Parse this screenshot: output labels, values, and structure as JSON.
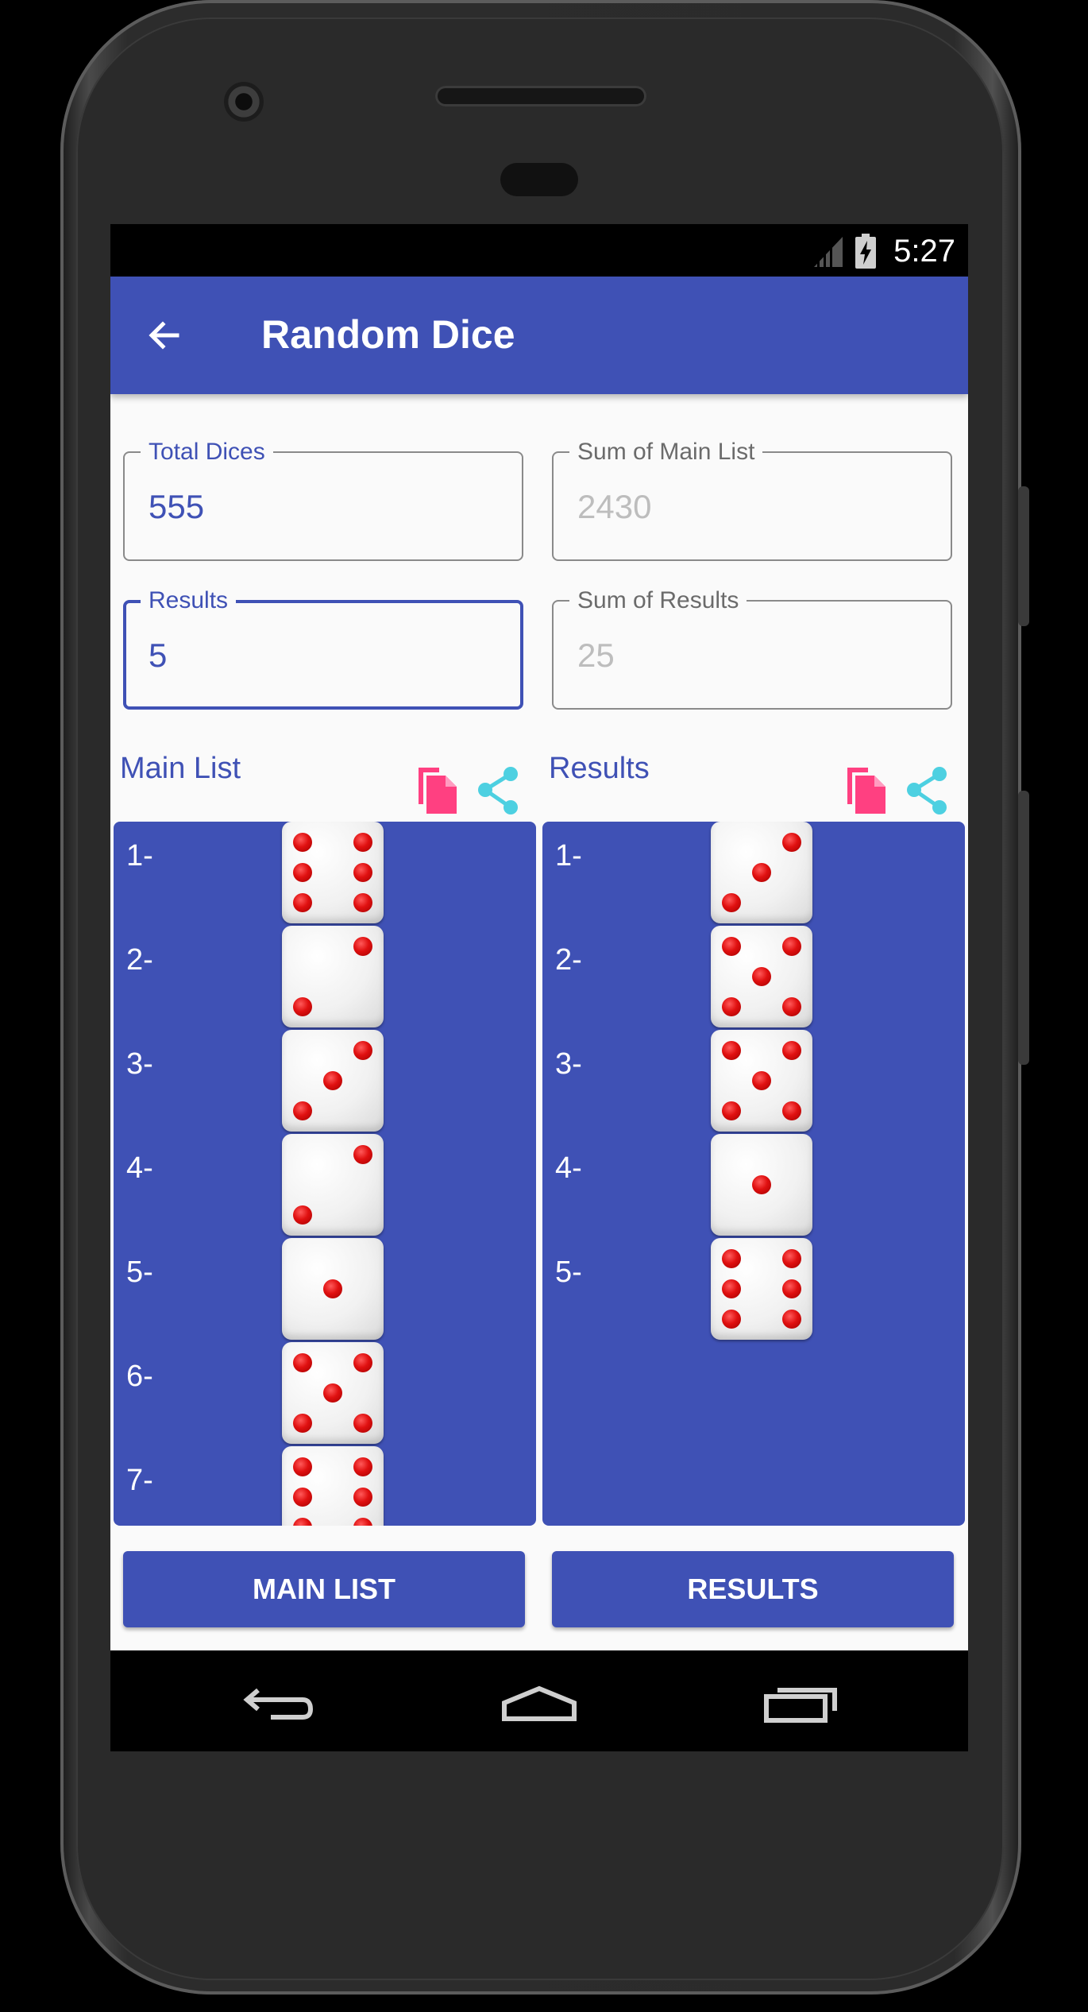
{
  "status_bar": {
    "time": "5:27"
  },
  "app_bar": {
    "title": "Random Dice"
  },
  "fields": {
    "total_dices": {
      "label": "Total Dices",
      "value": "555"
    },
    "sum_main_list": {
      "label": "Sum of Main List",
      "value": "2430"
    },
    "results": {
      "label": "Results",
      "value": "5"
    },
    "sum_results": {
      "label": "Sum of Results",
      "value": "25"
    }
  },
  "main_list": {
    "title": "Main List",
    "items": [
      {
        "index": "1-",
        "face": 6
      },
      {
        "index": "2-",
        "face": 2
      },
      {
        "index": "3-",
        "face": 3
      },
      {
        "index": "4-",
        "face": 2
      },
      {
        "index": "5-",
        "face": 1
      },
      {
        "index": "6-",
        "face": 5
      },
      {
        "index": "7-",
        "face": 6
      }
    ]
  },
  "results_list": {
    "title": "Results",
    "items": [
      {
        "index": "1-",
        "face": 3
      },
      {
        "index": "2-",
        "face": 5
      },
      {
        "index": "3-",
        "face": 5
      },
      {
        "index": "4-",
        "face": 1
      },
      {
        "index": "5-",
        "face": 6
      }
    ]
  },
  "buttons": {
    "main_list": "MAIN LIST",
    "results": "RESULTS"
  },
  "icons": {
    "copy": "copy-icon",
    "share": "share-icon",
    "back": "arrow-left-icon",
    "nav_back": "nav-back-icon",
    "nav_home": "nav-home-icon",
    "nav_recents": "nav-recents-icon"
  },
  "colors": {
    "primary": "#3f51b5",
    "copy_icon": "#ff4081",
    "share_icon": "#4dd0e1",
    "pip": "#e01010"
  }
}
